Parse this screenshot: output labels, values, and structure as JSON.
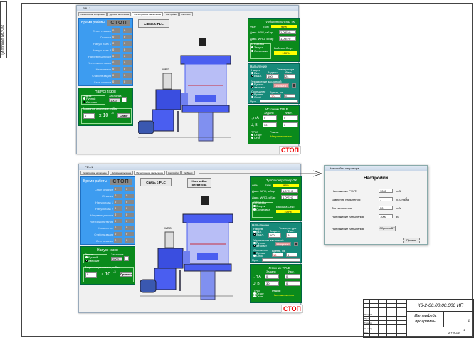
{
  "stamp_code": "ЦИ.000000.06-2-К6",
  "window": {
    "title": "РВЧ-1",
    "tabs": [
      "Термическое испарение",
      "Дуговое напыление",
      "Магнетронное распыление",
      "Настройки",
      "TabSheet"
    ],
    "active_tab": 2,
    "work_time_label": "Время работы",
    "status": "СТОП",
    "rows": [
      "Старт откачки",
      "Откачка",
      "Напуск газа 1",
      "Напуск газа 2",
      "Нагрев подложки",
      "Источник питания",
      "Напыление",
      "Стабилизация",
      "Стоп откачки"
    ],
    "row_value": "0",
    "plc_button": "Связь с PLC",
    "operator_settings_button": "Настройки оператора",
    "gas": {
      "title": "Напуск газов",
      "mode_group": "Режим",
      "mode_manual": "Ручной",
      "mode_auto": "Автомат",
      "valve_group": "Заслонка",
      "valve_value": "1000",
      "pressure_group": "Заданное давление, mBar",
      "pressure_value": "0",
      "exponent": "x 10",
      "exponent_power": "-3",
      "start_button": "Старт",
      "apply_button": "Принять"
    },
    "turbo": {
      "title": "Турбоконтроллер ТК",
      "fvn": "ФВН",
      "tmn": "ТМН",
      "tmn_value": "95%",
      "apg_label": "Давл. APG, мБар",
      "apg_value": "1,0*E+0",
      "wrg_label": "Давл. WRG, мБар",
      "wrg_value": "1,0*E+0",
      "pump_group": "ОТКАЧКА",
      "pump_start": "Запуск",
      "pump_stop": "Остановка",
      "butterfly_label": "Бабочка Откр",
      "butterfly_value": "100%"
    },
    "sputter": {
      "title": "Напыление",
      "heat_group": "Нагрев",
      "on": "Вкл.",
      "off": "Выкл.",
      "temp_label": "Температура",
      "set": "Задано",
      "actual": "Факт.",
      "temp_set": "100",
      "temp_actual": "24",
      "shutter_group": "Управление заслонкой",
      "manual": "Ручное",
      "auto": "автомат",
      "shutter_state": "Открыта",
      "end_group": "Окончание",
      "by_time": "Время",
      "by_layer": "Слой",
      "time_label": "Время, hs",
      "time_value": "10",
      "layer_value": "0",
      "progress_label": "Прог."
    },
    "tplb": {
      "title": "Источник TPLB",
      "set": "Задано",
      "actual": "Факт.",
      "i_label": "I, mA",
      "u_label": "U, B",
      "i_set": "0",
      "i_act": "0",
      "u_set": "30",
      "u_act": "0",
      "group": "TPLB",
      "start": "Старт",
      "stop": "Стоп",
      "mode_group": "Режим",
      "mode_value": "Напряжение/ток"
    },
    "valve_label": "WRG",
    "stop_indicator": "СТОП"
  },
  "dialog": {
    "title": "Настройки оператора",
    "heading": "Настройки",
    "fields": [
      {
        "label": "Напряжение PSVT:",
        "value": "1000",
        "unit": "mB"
      },
      {
        "label": "Давление напыления:",
        "value": "7",
        "unit": "x10 mБар"
      },
      {
        "label": "Ток напыления:",
        "value": "30",
        "unit": "mA"
      },
      {
        "label": "Напряжение напыления:",
        "value": "1000",
        "unit": "B"
      }
    ],
    "exp_power": "-3",
    "reset_label": "Напряжение напыления:",
    "reset_button": "Сбросить BV",
    "apply_button": "Принять"
  },
  "title_block": {
    "doc_code": "К6-2-06.00.00.000 ИП",
    "name_line1": "Интерфейс",
    "name_line2": "программы",
    "sheets": "11",
    "sheet": "1",
    "role_rows": [
      "Разраб.",
      "Пров.",
      "Т.контр.",
      "Н.контр.",
      "Утв."
    ],
    "org": "ЧГУ ИСиФ"
  }
}
